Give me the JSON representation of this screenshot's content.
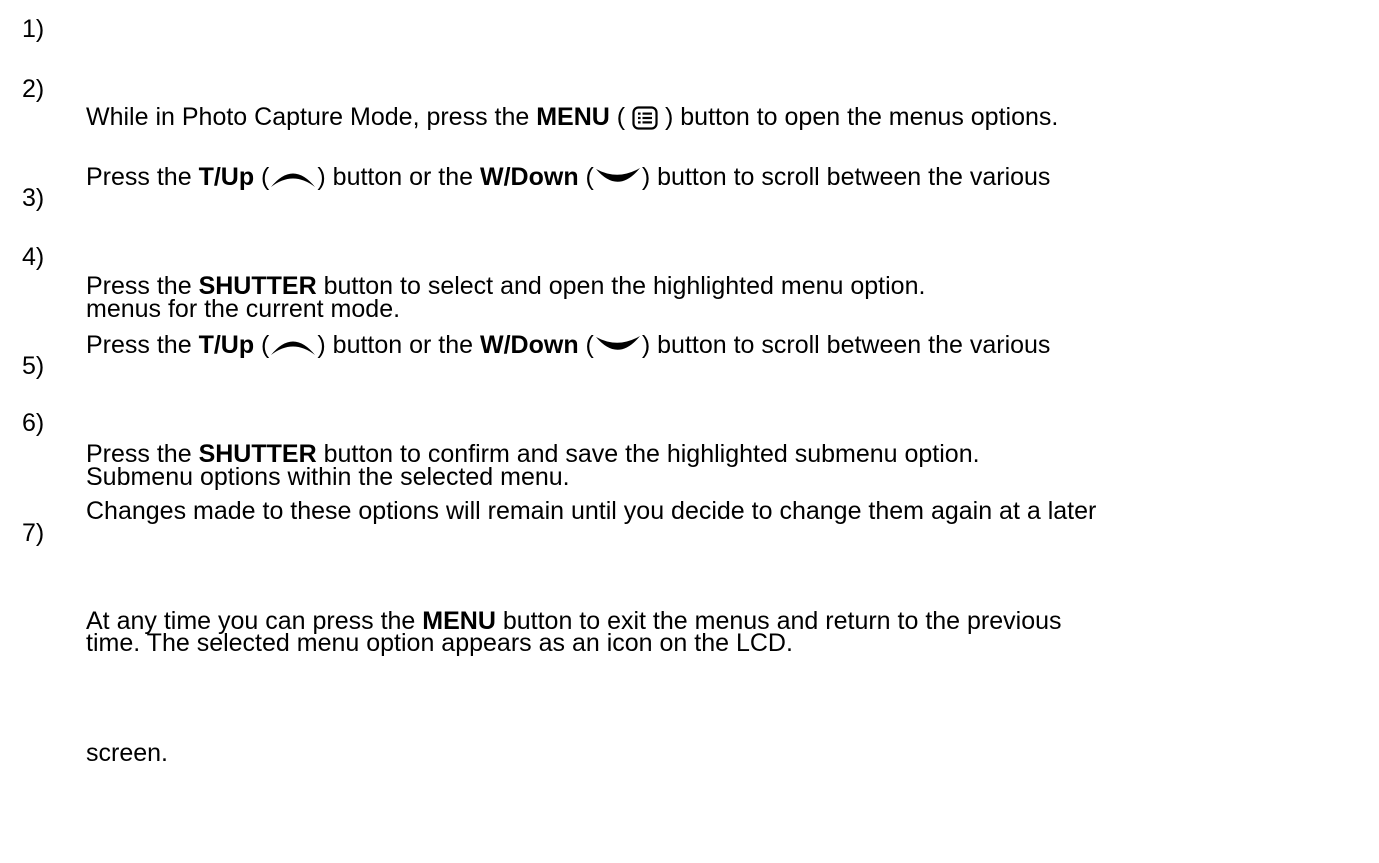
{
  "steps": [
    {
      "number": "1)",
      "a": "While in Photo Capture Mode, press the ",
      "menu_label": "MENU",
      "b": "  ( ",
      "menu_icon": "menu-list-icon",
      "c": " ) button to open the menus options."
    },
    {
      "number": "2)",
      "a": "Press the ",
      "up_label": "T/Up",
      "b": " (",
      "up_icon": "arrow-up-icon",
      "c": ") button or the ",
      "down_label": "W/Down",
      "d": " (",
      "down_icon": "arrow-down-icon",
      "e": ") button to scroll between the various",
      "line2": "menus for the current mode."
    },
    {
      "number": "3)",
      "a": "Press the ",
      "shutter_label": "SHUTTER",
      "b": " button to select and open the highlighted menu option."
    },
    {
      "number": "4)",
      "a": "Press the ",
      "up_label": "T/Up",
      "b": " (",
      "up_icon": "arrow-up-icon",
      "c": ") button or the ",
      "down_label": "W/Down",
      "d": " (",
      "down_icon": "arrow-down-icon",
      "e": ") button to scroll between the various",
      "line2": "Submenu options within the selected menu."
    },
    {
      "number": "5)",
      "a": "Press the ",
      "shutter_label": "SHUTTER",
      "b": " button to confirm and save the highlighted submenu option."
    },
    {
      "number": "6)",
      "line1": "Changes made to these options will remain until you decide to change them again at a later",
      "line2": "time. The selected menu option appears as an icon on the LCD."
    },
    {
      "number": "7)",
      "a": "At any time you can press the ",
      "menu_label": "MENU",
      "b": " button to exit the menus and return to the previous",
      "line2": "screen."
    }
  ]
}
